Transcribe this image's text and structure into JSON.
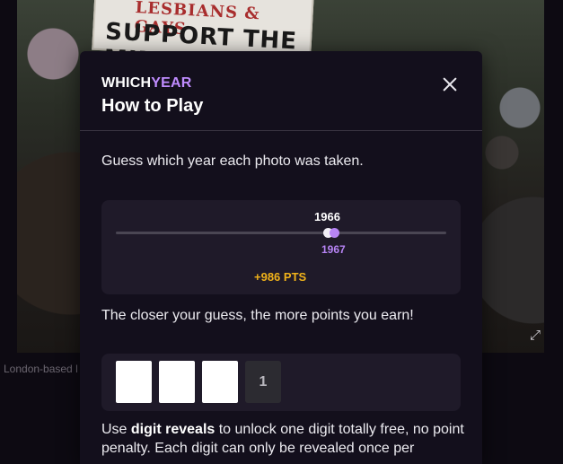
{
  "background": {
    "banner_line1": "LESBIANS & GAYS",
    "banner_line2": "SUPPORT THE MINERS",
    "caption": "London-based l"
  },
  "modal": {
    "brand_which": "WHICH",
    "brand_year": "YEAR",
    "title": "How to Play",
    "intro": "Guess which year each photo was taken.",
    "slider": {
      "guess_year": "1966",
      "answer_year": "1967",
      "points": "+986 PTS"
    },
    "closer_text": "The closer your guess, the more points you earn!",
    "digits": [
      "",
      "",
      "",
      "1"
    ],
    "reveals_prefix": "Use ",
    "reveals_bold": "digit reveals",
    "reveals_rest": " to unlock one digit totally free, no point penalty. Each digit can only be revealed once per"
  },
  "colors": {
    "accent": "#c08cff",
    "points": "#f0b21a",
    "modal_bg": "#130f1c",
    "card_bg": "#1f1a29"
  },
  "icons": {
    "close": "close-icon",
    "expand": "expand-icon"
  }
}
